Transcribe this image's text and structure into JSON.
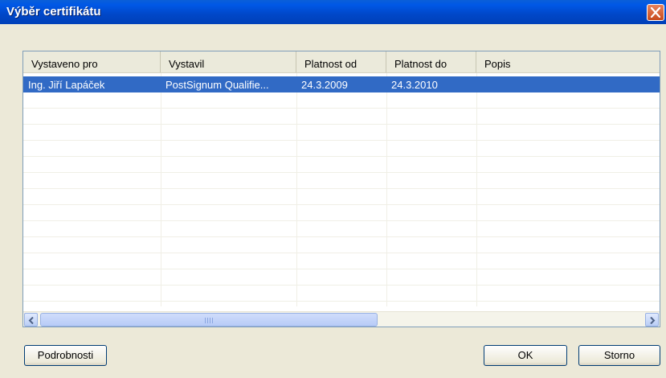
{
  "window": {
    "title": "Výběr certifikátu"
  },
  "table": {
    "columns": [
      "Vystaveno pro",
      "Vystavil",
      "Platnost od",
      "Platnost do",
      "Popis"
    ],
    "rows": [
      {
        "issued_to": "Ing. Jiří Lapáček",
        "issued_by": "PostSignum Qualifie...",
        "valid_from": "24.3.2009",
        "valid_to": "24.3.2010",
        "description": ""
      }
    ],
    "selected_row": 0
  },
  "buttons": {
    "details": "Podrobnosti",
    "ok": "OK",
    "cancel": "Storno"
  },
  "icons": {
    "close": "close-icon",
    "scroll_left": "arrow-left-icon",
    "scroll_right": "arrow-right-icon"
  },
  "colors": {
    "titlebar": "#0047c8",
    "selection": "#316ac5",
    "face": "#ece9d8"
  }
}
